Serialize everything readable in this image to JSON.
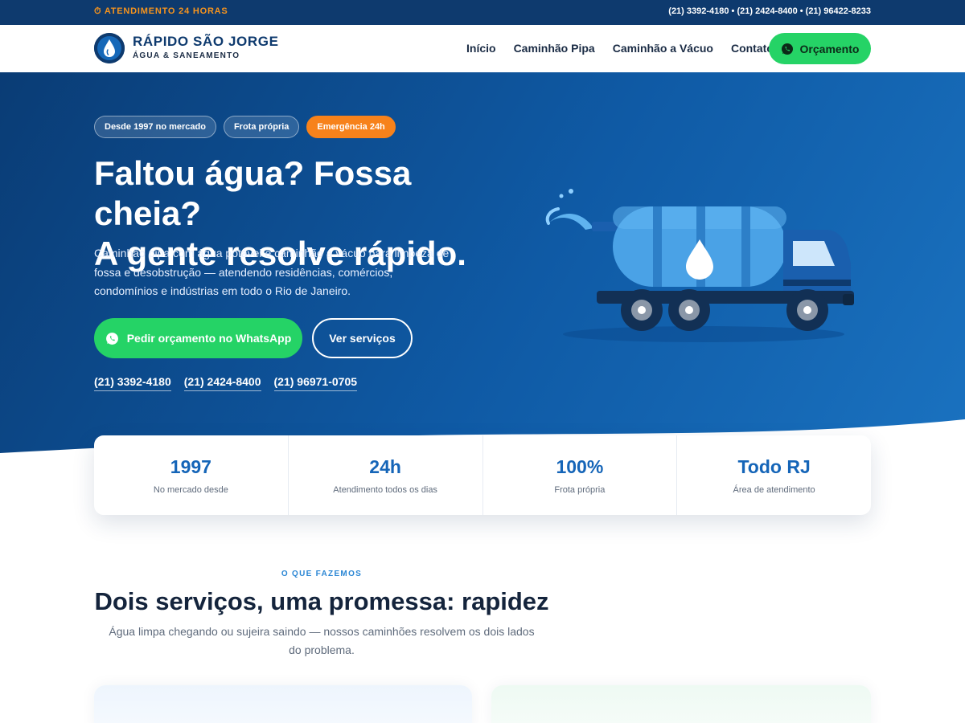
{
  "topbar": {
    "attend_icon": "clock-icon",
    "attend_label": "ATENDIMENTO 24 HORAS",
    "phones": "(21) 3392-4180 • (21) 2424-8400 • (21) 96422-8233"
  },
  "header": {
    "brand_name": "RÁPIDO SÃO JORGE",
    "brand_sub": "ÁGUA & SANEAMENTO",
    "nav": [
      "Início",
      "Caminhão Pipa",
      "Caminhão a Vácuo",
      "Contato"
    ],
    "cta_label": "Orçamento"
  },
  "hero": {
    "badges": [
      "Desde 1997 no mercado",
      "Frota própria",
      "Emergência 24h"
    ],
    "title_line1": "Faltou água? Fossa cheia?",
    "title_line2": "A gente resolve rápido.",
    "text": "Caminhão pipa com água potável e caminhão a vácuo para limpeza de fossa e desobstrução — atendendo residências, comércios, condomínios e indústrias em todo o Rio de Janeiro.",
    "whatsapp_label": "Pedir orçamento no WhatsApp",
    "services_label": "Ver serviços",
    "phones": [
      "(21) 3392-4180",
      "(21) 2424-8400",
      "(21) 96971-0705"
    ]
  },
  "stats": [
    {
      "value": "1997",
      "label": "No mercado desde"
    },
    {
      "value": "24h",
      "label": "Atendimento todos os dias"
    },
    {
      "value": "100%",
      "label": "Frota própria"
    },
    {
      "value": "Todo RJ",
      "label": "Área de atendimento"
    }
  ],
  "section": {
    "kicker": "O QUE FAZEMOS",
    "title": "Dois serviços, uma promessa: rapidez",
    "text": "Água limpa chegando ou sujeira saindo — nossos caminhões resolvem os dois lados do problema."
  },
  "colors": {
    "accent": "#25d366",
    "orange": "#f7821b",
    "navy": "#0e3a6e",
    "blue": "#1565b8"
  }
}
